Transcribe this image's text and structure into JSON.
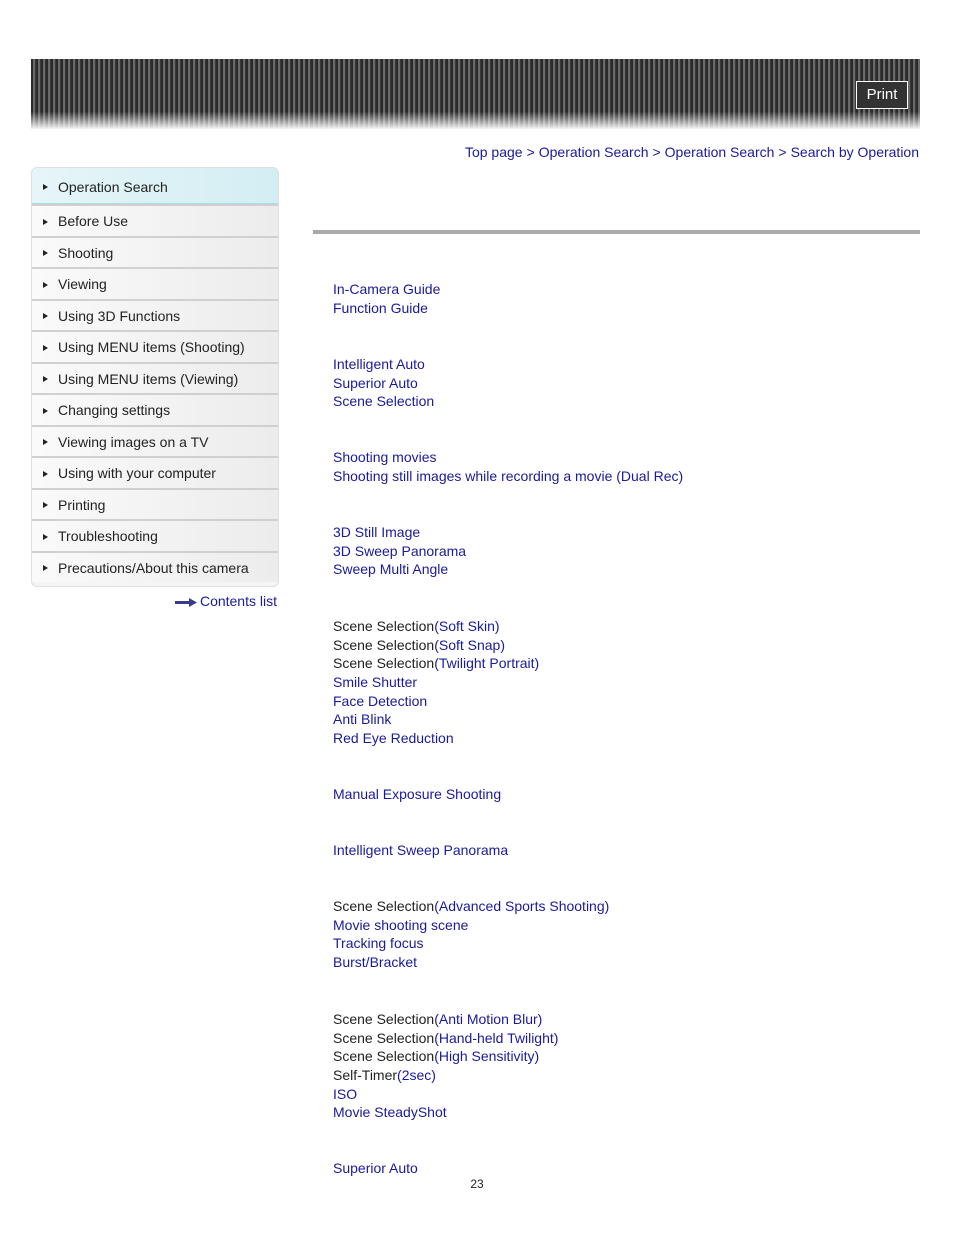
{
  "header": {
    "print_label": "Print"
  },
  "breadcrumb": [
    "Top page",
    "Operation Search",
    "Operation Search",
    "Search by Operation"
  ],
  "breadcrumb_sep": ">",
  "sidebar": {
    "items": [
      {
        "label": "Operation Search",
        "active": true
      },
      {
        "label": "Before Use"
      },
      {
        "label": "Shooting"
      },
      {
        "label": "Viewing"
      },
      {
        "label": "Using 3D Functions"
      },
      {
        "label": "Using MENU items (Shooting)"
      },
      {
        "label": "Using MENU items (Viewing)"
      },
      {
        "label": "Changing settings"
      },
      {
        "label": "Viewing images on a TV"
      },
      {
        "label": "Using with your computer"
      },
      {
        "label": "Printing"
      },
      {
        "label": "Troubleshooting"
      },
      {
        "label": "Precautions/About this camera"
      }
    ],
    "contents_list": "Contents list"
  },
  "groups": [
    {
      "lines": [
        {
          "link": "In-Camera Guide"
        },
        {
          "link": "Function Guide"
        }
      ]
    },
    {
      "lines": [
        {
          "link": "Intelligent Auto"
        },
        {
          "link": "Superior Auto"
        },
        {
          "link": "Scene Selection"
        }
      ]
    },
    {
      "lines": [
        {
          "link": "Shooting movies"
        },
        {
          "link": "Shooting still images while recording a movie (Dual Rec)"
        }
      ]
    },
    {
      "lines": [
        {
          "link": "3D Still Image"
        },
        {
          "link": "3D Sweep Panorama"
        },
        {
          "link": "Sweep Multi Angle"
        }
      ]
    },
    {
      "lines": [
        {
          "prefix": "Scene Selection",
          "link": "(Soft Skin)"
        },
        {
          "prefix": "Scene Selection",
          "link": "(Soft Snap)"
        },
        {
          "prefix": "Scene Selection",
          "link": "(Twilight Portrait)"
        },
        {
          "link": "Smile Shutter"
        },
        {
          "link": "Face Detection"
        },
        {
          "link": "Anti Blink"
        },
        {
          "link": "Red Eye Reduction"
        }
      ]
    },
    {
      "lines": [
        {
          "link": "Manual Exposure Shooting"
        }
      ]
    },
    {
      "lines": [
        {
          "link": "Intelligent Sweep Panorama"
        }
      ]
    },
    {
      "lines": [
        {
          "prefix": "Scene Selection",
          "link": "(Advanced Sports Shooting)"
        },
        {
          "link": "Movie shooting scene"
        },
        {
          "link": "Tracking focus"
        },
        {
          "link": "Burst/Bracket"
        }
      ]
    },
    {
      "lines": [
        {
          "prefix": "Scene Selection",
          "link": "(Anti Motion Blur)"
        },
        {
          "prefix": "Scene Selection",
          "link": "(Hand-held Twilight)"
        },
        {
          "prefix": "Scene Selection",
          "link": "(High Sensitivity)"
        },
        {
          "prefix": "Self-Timer",
          "link": "(2sec)"
        },
        {
          "link": "ISO"
        },
        {
          "link": "Movie SteadyShot"
        }
      ]
    },
    {
      "lines": [
        {
          "link": "Superior Auto"
        }
      ]
    }
  ],
  "page_number": "23"
}
